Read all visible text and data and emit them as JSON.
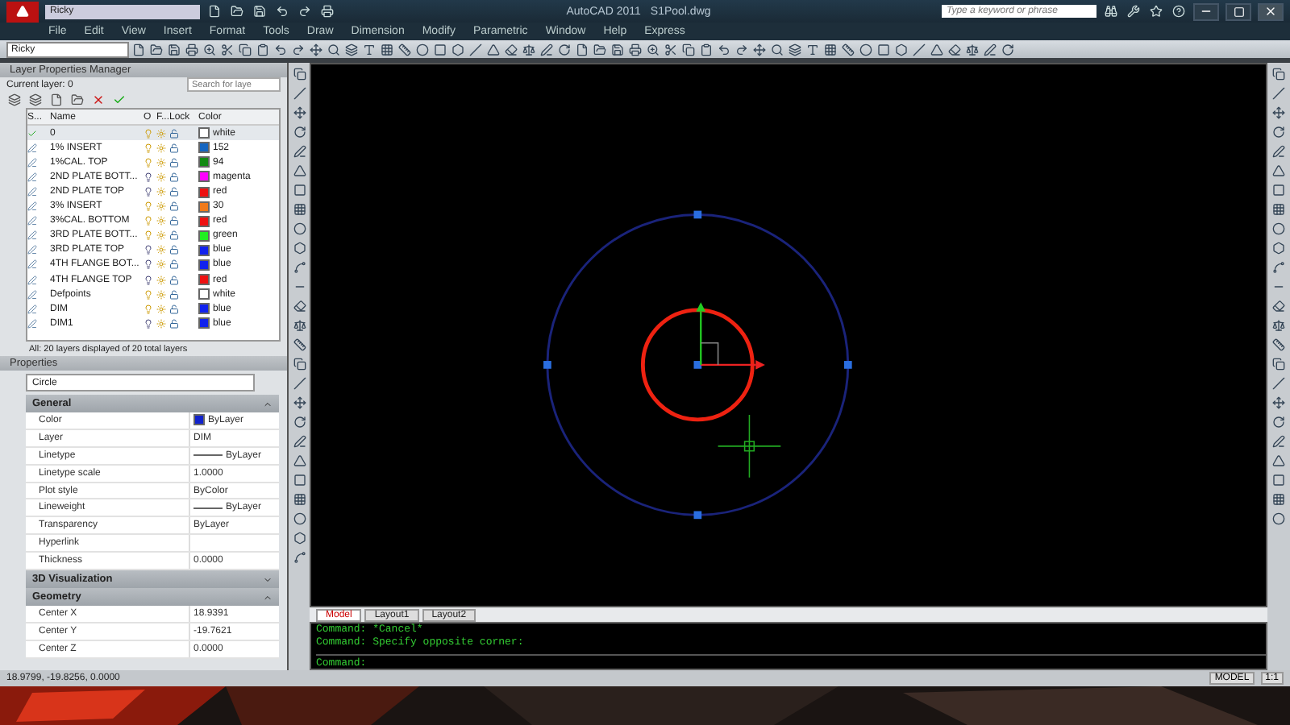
{
  "title_bar": {
    "workspace": "Ricky",
    "title": "AutoCAD 2011",
    "file": "S1Pool.dwg",
    "search": {
      "placeholder": "Type a keyword or phrase"
    }
  },
  "menu": [
    "File",
    "Edit",
    "View",
    "Insert",
    "Format",
    "Tools",
    "Draw",
    "Dimension",
    "Modify",
    "Parametric",
    "Window",
    "Help",
    "Express"
  ],
  "toolbar": {
    "workspace": "Ricky"
  },
  "layer_manager": {
    "title": "Layer Properties Manager",
    "current_layer": "Current layer: 0",
    "search": {
      "placeholder": "Search for laye"
    },
    "columns": [
      "S...",
      "Name",
      "O",
      "F...",
      "Lock",
      "Color"
    ],
    "layers": [
      {
        "name": "0",
        "current": true,
        "on": true,
        "color": "#ffffff",
        "color_name": "white"
      },
      {
        "name": "1% INSERT",
        "current": false,
        "on": true,
        "color": "#1565c0",
        "color_name": "152"
      },
      {
        "name": "1%CAL. TOP",
        "current": false,
        "on": true,
        "color": "#138a13",
        "color_name": "94"
      },
      {
        "name": "2ND PLATE BOTT...",
        "current": false,
        "on": false,
        "color": "#ff00ff",
        "color_name": "magenta"
      },
      {
        "name": "2ND PLATE TOP",
        "current": false,
        "on": false,
        "color": "#ee1111",
        "color_name": "red"
      },
      {
        "name": "3% INSERT",
        "current": false,
        "on": true,
        "color": "#f07a1a",
        "color_name": "30"
      },
      {
        "name": "3%CAL. BOTTOM",
        "current": false,
        "on": true,
        "color": "#ee1111",
        "color_name": "red"
      },
      {
        "name": "3RD PLATE BOTT...",
        "current": false,
        "on": true,
        "color": "#22ee22",
        "color_name": "green"
      },
      {
        "name": "3RD PLATE TOP",
        "current": false,
        "on": false,
        "color": "#1122ee",
        "color_name": "blue"
      },
      {
        "name": "4TH FLANGE BOT...",
        "current": false,
        "on": false,
        "color": "#1122ee",
        "color_name": "blue"
      },
      {
        "name": "4TH FLANGE TOP",
        "current": false,
        "on": false,
        "color": "#ee1111",
        "color_name": "red"
      },
      {
        "name": "Defpoints",
        "current": false,
        "on": true,
        "color": "#ffffff",
        "color_name": "white"
      },
      {
        "name": "DIM",
        "current": false,
        "on": true,
        "color": "#1122ee",
        "color_name": "blue"
      },
      {
        "name": "DIM1",
        "current": false,
        "on": false,
        "color": "#1122ee",
        "color_name": "blue"
      }
    ],
    "footer": "All: 20 layers displayed of 20 total layers"
  },
  "properties": {
    "title": "Properties",
    "selection": "Circle",
    "sections": [
      {
        "title": "General",
        "expanded": true,
        "rows": [
          {
            "label": "Color",
            "value": "ByLayer",
            "kind": "swatch",
            "color": "#1122cc"
          },
          {
            "label": "Layer",
            "value": "DIM",
            "kind": "text"
          },
          {
            "label": "Linetype",
            "value": "ByLayer",
            "kind": "line"
          },
          {
            "label": "Linetype scale",
            "value": "1.0000",
            "kind": "text"
          },
          {
            "label": "Plot style",
            "value": "ByColor",
            "kind": "text"
          },
          {
            "label": "Lineweight",
            "value": "ByLayer",
            "kind": "line"
          },
          {
            "label": "Transparency",
            "value": "ByLayer",
            "kind": "text"
          },
          {
            "label": "Hyperlink"
          },
          {
            "label": "Thickness",
            "value": "0.0000",
            "kind": "text"
          }
        ]
      },
      {
        "title": "3D Visualization",
        "expanded": false
      },
      {
        "title": "Geometry",
        "expanded": true,
        "rows": [
          {
            "label": "Center X",
            "value": "18.9391",
            "kind": "text"
          },
          {
            "label": "Center Y",
            "value": "-19.7621",
            "kind": "text"
          },
          {
            "label": "Center Z",
            "value": "0.0000",
            "kind": "text"
          }
        ]
      }
    ]
  },
  "layout_tabs": [
    {
      "label": "Model",
      "selected": true
    },
    {
      "label": "Layout1",
      "selected": false
    },
    {
      "label": "Layout2",
      "selected": false
    }
  ],
  "command_history": [
    "Command: *Cancel*",
    "Command: Specify opposite corner:"
  ],
  "command_prompt": "Command:",
  "status_bar": {
    "coordinates": "18.9799, -19.8256, 0.0000",
    "space": "MODEL",
    "scale": "1:1"
  }
}
